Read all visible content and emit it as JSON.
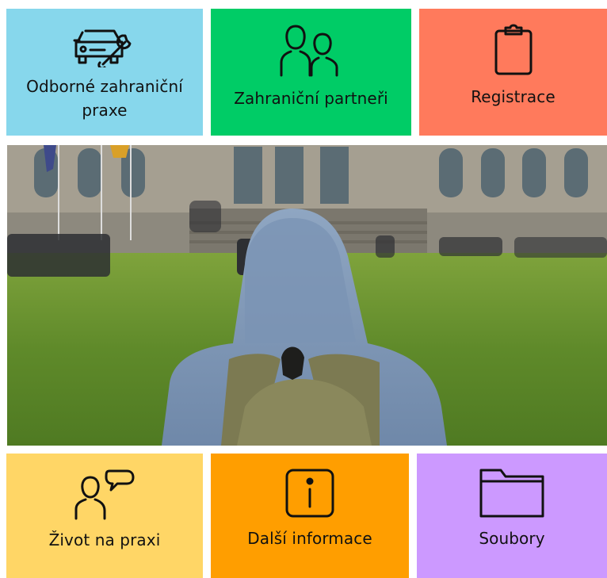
{
  "colors": {
    "tile_praxe": "#87D7EC",
    "tile_partneri": "#00CC66",
    "tile_registrace": "#FF7A5C",
    "tile_zivot": "#FFD666",
    "tile_informace": "#FF9E00",
    "tile_soubory": "#CC99FF",
    "text": "#111111"
  },
  "tiles": [
    {
      "label": "Odborné zahraniční praxe",
      "icon": "car-wrench-icon"
    },
    {
      "label": "Zahraniční partneři",
      "icon": "two-people-icon"
    },
    {
      "label": "Registrace",
      "icon": "clipboard-icon"
    },
    {
      "label": "Život na praxi",
      "icon": "person-speech-icon"
    },
    {
      "label": "Další informace",
      "icon": "info-icon"
    },
    {
      "label": "Soubory",
      "icon": "folder-icon"
    }
  ]
}
